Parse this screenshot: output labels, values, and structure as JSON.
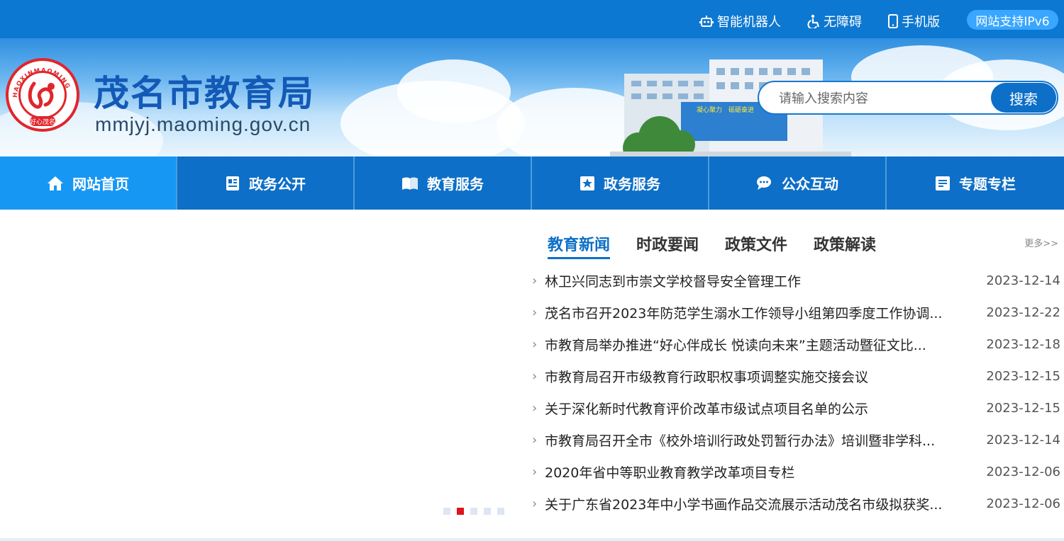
{
  "topbar": {
    "robot_label": "智能机器人",
    "accessible_label": "无障碍",
    "mobile_label": "手机版",
    "ipv6_label": "网站支持IPv6"
  },
  "header": {
    "site_title": "茂名市教育局",
    "site_domain": "mmjyj.maoming.gov.cn",
    "logo_text_top": "HAOXINMAOMING",
    "logo_text_bottom": "好心茂名",
    "building_sign": "凝心聚力　砥砺奋进"
  },
  "search": {
    "placeholder": "请输入搜索内容",
    "button_label": "搜索"
  },
  "nav": {
    "items": [
      {
        "label": "网站首页",
        "icon": "home-icon"
      },
      {
        "label": "政务公开",
        "icon": "document-icon"
      },
      {
        "label": "教育服务",
        "icon": "book-icon"
      },
      {
        "label": "政务服务",
        "icon": "star-icon"
      },
      {
        "label": "公众互动",
        "icon": "chat-icon"
      },
      {
        "label": "专题专栏",
        "icon": "list-icon"
      }
    ],
    "active_index": 0
  },
  "slider": {
    "dot_count": 5,
    "active_dot": 1
  },
  "news": {
    "tabs": [
      "教育新闻",
      "时政要闻",
      "政策文件",
      "政策解读"
    ],
    "active_tab": 0,
    "more_label": "更多>>",
    "items": [
      {
        "title": "林卫兴同志到市崇文学校督导安全管理工作",
        "date": "2023-12-14"
      },
      {
        "title": "茂名市召开2023年防范学生溺水工作领导小组第四季度工作协调...",
        "date": "2023-12-22"
      },
      {
        "title": "市教育局举办推进“好心伴成长 悦读向未来”主题活动暨征文比...",
        "date": "2023-12-18"
      },
      {
        "title": "市教育局召开市级教育行政职权事项调整实施交接会议",
        "date": "2023-12-15"
      },
      {
        "title": "关于深化新时代教育评价改革市级试点项目名单的公示",
        "date": "2023-12-15"
      },
      {
        "title": "市教育局召开全市《校外培训行政处罚暂行办法》培训暨非学科...",
        "date": "2023-12-14"
      },
      {
        "title": "2020年省中等职业教育教学改革项目专栏",
        "date": "2023-12-06"
      },
      {
        "title": "关于广东省2023年中小学书画作品交流展示活动茂名市级拟获奖...",
        "date": "2023-12-06"
      }
    ]
  },
  "colors": {
    "primary": "#0d6fc7",
    "topbar": "#0d78d1",
    "nav_active": "#1797f4",
    "logo_red": "#e0262c",
    "dot_active": "#e0141e"
  }
}
